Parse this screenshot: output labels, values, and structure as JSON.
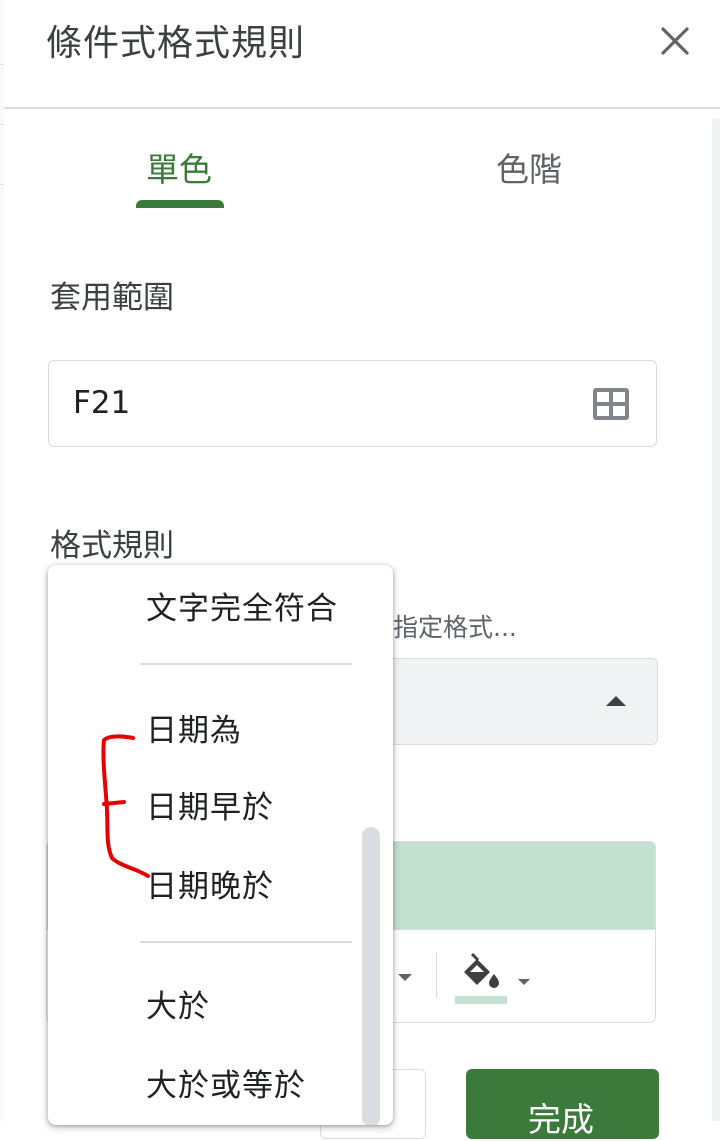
{
  "panel": {
    "title": "條件式格式規則",
    "close_icon": "close-icon"
  },
  "tabs": [
    {
      "label": "單色",
      "selected": true
    },
    {
      "label": "色階",
      "selected": false
    }
  ],
  "range": {
    "label": "套用範圍",
    "value": "F21",
    "icon": "grid-select-icon"
  },
  "format_rules": {
    "label": "格式規則",
    "hint": "用指定格式..."
  },
  "menu": {
    "items": [
      "文字完全符合",
      "日期為",
      "日期早於",
      "日期晚於",
      "大於",
      "大於或等於"
    ]
  },
  "buttons": {
    "done_label": "完成"
  },
  "colors": {
    "accent": "#3c7a3c",
    "preview_fill": "#c3e0d0",
    "annotation": "#e60000"
  }
}
